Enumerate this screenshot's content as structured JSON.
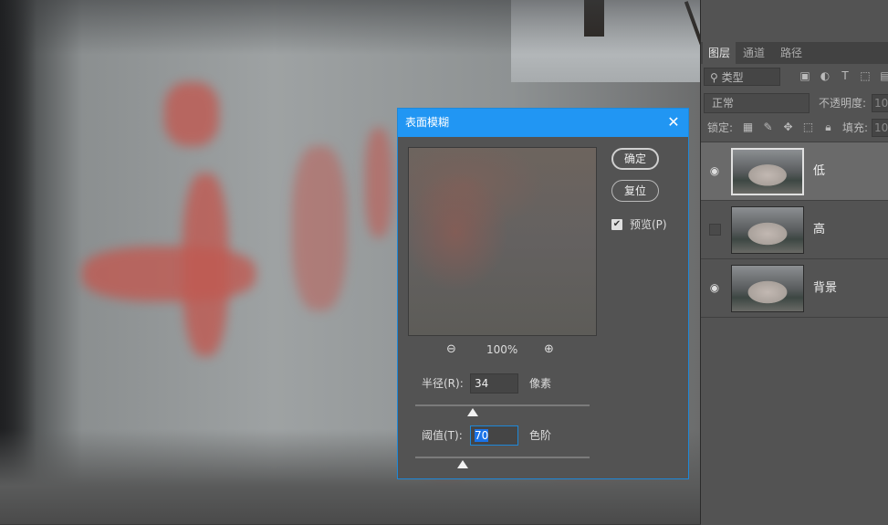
{
  "layers_panel": {
    "tabs": [
      "图层",
      "通道",
      "路径"
    ],
    "kind_filter": "类型",
    "blend_mode": "正常",
    "opacity_label": "不透明度:",
    "opacity_value": "10",
    "lock_label": "锁定:",
    "fill_label": "填充:",
    "fill_value": "10",
    "layers": [
      {
        "name": "低",
        "visible": true,
        "selected": true
      },
      {
        "name": "高",
        "visible": false,
        "selected": false
      },
      {
        "name": "背景",
        "visible": true,
        "selected": false
      }
    ]
  },
  "dialog": {
    "title": "表面模糊",
    "ok_label": "确定",
    "reset_label": "复位",
    "preview_label": "预览(P)",
    "preview_checked": true,
    "zoom_percent": "100%",
    "radius": {
      "label": "半径(R):",
      "value": "34",
      "unit": "像素",
      "slider_fraction": 0.33
    },
    "threshold": {
      "label": "阈值(T):",
      "value": "70",
      "unit": "色阶",
      "slider_fraction": 0.27
    }
  },
  "colors": {
    "accent": "#2196f3",
    "panel": "#535353"
  }
}
